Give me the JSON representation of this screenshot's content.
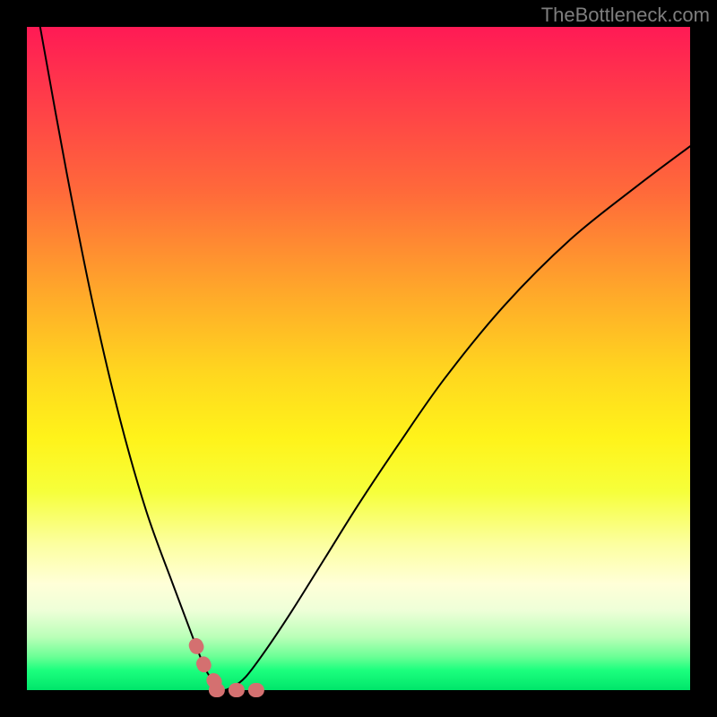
{
  "watermark": {
    "text": "TheBottleneck.com"
  },
  "chart_data": {
    "type": "line",
    "title": "",
    "xlabel": "",
    "ylabel": "",
    "xlim": [
      0,
      100
    ],
    "ylim": [
      0,
      100
    ],
    "grid": false,
    "series": [
      {
        "name": "bottleneck-curve",
        "x": [
          2,
          6,
          10,
          14,
          18,
          22,
          25,
          27,
          28.5,
          29.5,
          31,
          33,
          36,
          40,
          45,
          50,
          56,
          63,
          72,
          82,
          92,
          100
        ],
        "y": [
          100,
          78,
          58,
          41,
          27,
          16,
          8,
          3,
          1,
          0,
          0.5,
          2,
          6,
          12,
          20,
          28,
          37,
          47,
          58,
          68,
          76,
          82
        ]
      }
    ],
    "annotation_region": {
      "name": "optimal-range",
      "x_start": 25.5,
      "x_end": 35,
      "description": "near-zero bottleneck band highlighted in pink"
    },
    "background_gradient": {
      "top_color": "#ff1a55",
      "mid_color": "#ffe01a",
      "bottom_color": "#00e56a"
    }
  }
}
